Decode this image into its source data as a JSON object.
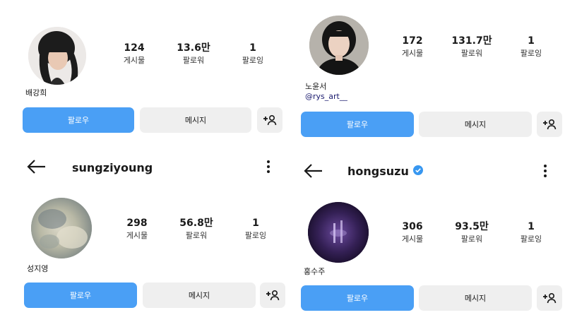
{
  "profiles": [
    {
      "name": "배강희",
      "posts": "124",
      "followers": "13.6만",
      "following": "1",
      "labels": {
        "posts": "게시물",
        "followers": "팔로워",
        "following": "팔로잉"
      },
      "follow_label": "팔로우",
      "message_label": "메시지"
    },
    {
      "name": "노윤서",
      "handle": "@rys_art__",
      "posts": "172",
      "followers": "131.7만",
      "following": "1",
      "labels": {
        "posts": "게시물",
        "followers": "팔로워",
        "following": "팔로잉"
      },
      "follow_label": "팔로우",
      "message_label": "메시지"
    },
    {
      "username": "sungziyoung",
      "name": "성지영",
      "posts": "298",
      "followers": "56.8만",
      "following": "1",
      "labels": {
        "posts": "게시물",
        "followers": "팔로워",
        "following": "팔로잉"
      },
      "follow_label": "팔로우",
      "message_label": "메시지"
    },
    {
      "username": "hongsuzu",
      "verified": true,
      "name": "홍수주",
      "posts": "306",
      "followers": "93.5만",
      "following": "1",
      "labels": {
        "posts": "게시물",
        "followers": "팔로워",
        "following": "팔로잉"
      },
      "follow_label": "팔로우",
      "message_label": "메시지"
    }
  ],
  "colors": {
    "follow_button": "#4a9ff5",
    "secondary_button": "#efefef",
    "verified_badge": "#3897f0"
  },
  "icons": {
    "back": "arrow-left-icon",
    "more": "more-vertical-icon",
    "add_user": "person-add-icon",
    "verified": "verified-badge-icon"
  }
}
